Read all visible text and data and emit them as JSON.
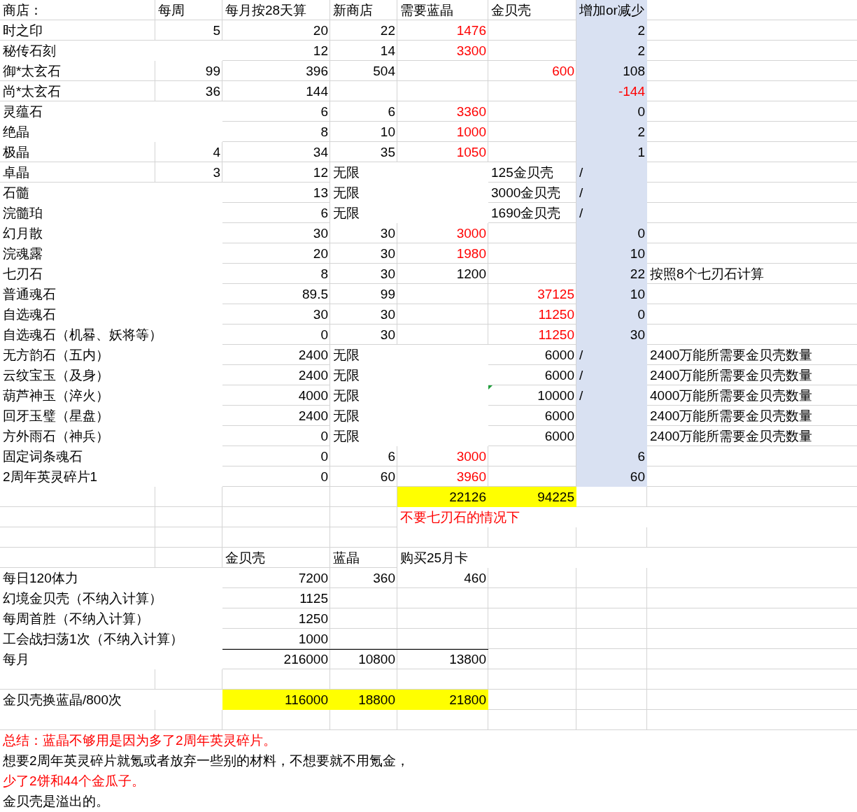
{
  "rows": [
    {
      "cells": [
        {
          "text": "商店：",
          "kind": "text"
        },
        {
          "text": "每周",
          "kind": "text"
        },
        {
          "text": "每月按28天算",
          "kind": "text"
        },
        {
          "text": "新商店",
          "kind": "text"
        },
        {
          "text": "需要蓝晶",
          "kind": "text"
        },
        {
          "text": "金贝壳",
          "kind": "text"
        },
        {
          "text": "增加or减少",
          "kind": "delta-text"
        },
        null
      ]
    },
    {
      "cells": [
        {
          "text": "时之印",
          "kind": "text"
        },
        {
          "text": "5",
          "kind": "number"
        },
        {
          "text": "20",
          "kind": "number"
        },
        {
          "text": "22",
          "kind": "number"
        },
        {
          "text": "1476",
          "kind": "number",
          "color": "#ff0000"
        },
        null,
        {
          "text": "2",
          "kind": "delta"
        },
        null
      ]
    },
    {
      "cells": [
        {
          "text": "秘传石刻",
          "kind": "text"
        },
        null,
        {
          "text": "12",
          "kind": "number"
        },
        {
          "text": "14",
          "kind": "number"
        },
        {
          "text": "3300",
          "kind": "number",
          "color": "#ff0000"
        },
        null,
        {
          "text": "2",
          "kind": "delta"
        },
        null
      ]
    },
    {
      "cells": [
        {
          "text": "御*太玄石",
          "kind": "text"
        },
        {
          "text": "99",
          "kind": "number"
        },
        {
          "text": "396",
          "kind": "number"
        },
        {
          "text": "504",
          "kind": "number"
        },
        null,
        {
          "text": "600",
          "kind": "number",
          "color": "#ff0000"
        },
        {
          "text": "108",
          "kind": "delta"
        },
        null
      ]
    },
    {
      "cells": [
        {
          "text": "尚*太玄石",
          "kind": "text"
        },
        {
          "text": "36",
          "kind": "number"
        },
        {
          "text": "144",
          "kind": "number"
        },
        null,
        null,
        null,
        {
          "text": "-144",
          "kind": "delta",
          "color": "#ff0000"
        },
        null
      ]
    },
    {
      "cells": [
        {
          "text": "灵蕴石",
          "kind": "text"
        },
        null,
        {
          "text": "6",
          "kind": "number"
        },
        {
          "text": "6",
          "kind": "number"
        },
        {
          "text": "3360",
          "kind": "number",
          "color": "#ff0000"
        },
        null,
        {
          "text": "0",
          "kind": "delta"
        },
        null
      ]
    },
    {
      "cells": [
        {
          "text": "绝晶",
          "kind": "text"
        },
        null,
        {
          "text": "8",
          "kind": "number"
        },
        {
          "text": "10",
          "kind": "number"
        },
        {
          "text": "1000",
          "kind": "number",
          "color": "#ff0000"
        },
        null,
        {
          "text": "2",
          "kind": "delta"
        },
        null
      ]
    },
    {
      "cells": [
        {
          "text": "极晶",
          "kind": "text"
        },
        {
          "text": "4",
          "kind": "number"
        },
        {
          "text": "34",
          "kind": "number"
        },
        {
          "text": "35",
          "kind": "number"
        },
        {
          "text": "1050",
          "kind": "number",
          "color": "#ff0000"
        },
        null,
        {
          "text": "1",
          "kind": "delta"
        },
        null
      ]
    },
    {
      "cells": [
        {
          "text": "卓晶",
          "kind": "text"
        },
        {
          "text": "3",
          "kind": "number"
        },
        {
          "text": "12",
          "kind": "number"
        },
        {
          "text": "无限",
          "kind": "text"
        },
        null,
        {
          "text": "125金贝壳",
          "kind": "text"
        },
        {
          "text": "/",
          "kind": "delta-text"
        },
        null
      ]
    },
    {
      "cells": [
        {
          "text": "石髓",
          "kind": "text"
        },
        null,
        {
          "text": "13",
          "kind": "number"
        },
        {
          "text": "无限",
          "kind": "text"
        },
        null,
        {
          "text": "3000金贝壳",
          "kind": "text"
        },
        {
          "text": "/",
          "kind": "delta-text"
        },
        null
      ]
    },
    {
      "cells": [
        {
          "text": "浣髓珀",
          "kind": "text"
        },
        null,
        {
          "text": "6",
          "kind": "number"
        },
        {
          "text": "无限",
          "kind": "text"
        },
        null,
        {
          "text": "1690金贝壳",
          "kind": "text"
        },
        {
          "text": "/",
          "kind": "delta-text"
        },
        null
      ]
    },
    {
      "cells": [
        {
          "text": "幻月散",
          "kind": "text"
        },
        null,
        {
          "text": "30",
          "kind": "number"
        },
        {
          "text": "30",
          "kind": "number"
        },
        {
          "text": "3000",
          "kind": "number",
          "color": "#ff0000"
        },
        null,
        {
          "text": "0",
          "kind": "delta"
        },
        null
      ]
    },
    {
      "cells": [
        {
          "text": "浣魂露",
          "kind": "text"
        },
        null,
        {
          "text": "20",
          "kind": "number"
        },
        {
          "text": "30",
          "kind": "number"
        },
        {
          "text": "1980",
          "kind": "number",
          "color": "#ff0000"
        },
        null,
        {
          "text": "10",
          "kind": "delta"
        },
        null
      ]
    },
    {
      "cells": [
        {
          "text": "七刃石",
          "kind": "text"
        },
        null,
        {
          "text": "8",
          "kind": "number"
        },
        {
          "text": "30",
          "kind": "number"
        },
        {
          "text": "1200",
          "kind": "number"
        },
        null,
        {
          "text": "22",
          "kind": "delta"
        },
        {
          "text": "按照8个七刃石计算",
          "kind": "text"
        }
      ]
    },
    {
      "cells": [
        {
          "text": "普通魂石",
          "kind": "text"
        },
        null,
        {
          "text": "89.5",
          "kind": "number"
        },
        {
          "text": "99",
          "kind": "number"
        },
        null,
        {
          "text": "37125",
          "kind": "number",
          "color": "#ff0000"
        },
        {
          "text": "10",
          "kind": "delta"
        },
        null
      ]
    },
    {
      "cells": [
        {
          "text": "自选魂石",
          "kind": "text"
        },
        null,
        {
          "text": "30",
          "kind": "number"
        },
        {
          "text": "30",
          "kind": "number"
        },
        null,
        {
          "text": "11250",
          "kind": "number",
          "color": "#ff0000"
        },
        {
          "text": "0",
          "kind": "delta"
        },
        null
      ]
    },
    {
      "cells": [
        {
          "text": "自选魂石（机晷、妖将等）",
          "kind": "text"
        },
        null,
        {
          "text": "0",
          "kind": "number"
        },
        {
          "text": "30",
          "kind": "number"
        },
        null,
        {
          "text": "11250",
          "kind": "number",
          "color": "#ff0000"
        },
        {
          "text": "30",
          "kind": "delta"
        },
        null
      ]
    },
    {
      "cells": [
        {
          "text": "无方韵石（五内）",
          "kind": "text"
        },
        null,
        {
          "text": "2400",
          "kind": "number"
        },
        {
          "text": "无限",
          "kind": "text"
        },
        null,
        {
          "text": "6000",
          "kind": "number"
        },
        {
          "text": "/",
          "kind": "delta-text"
        },
        {
          "text": "2400万能所需要金贝壳数量",
          "kind": "text"
        }
      ]
    },
    {
      "cells": [
        {
          "text": "云纹宝玉（及身）",
          "kind": "text"
        },
        null,
        {
          "text": "2400",
          "kind": "number"
        },
        {
          "text": "无限",
          "kind": "text"
        },
        null,
        {
          "text": "6000",
          "kind": "number"
        },
        {
          "text": "/",
          "kind": "delta-text"
        },
        {
          "text": "2400万能所需要金贝壳数量",
          "kind": "text"
        }
      ]
    },
    {
      "cells": [
        {
          "text": "葫芦神玉（淬火）",
          "kind": "text"
        },
        null,
        {
          "text": "4000",
          "kind": "number"
        },
        {
          "text": "无限",
          "kind": "text"
        },
        null,
        {
          "text": "10000",
          "kind": "number",
          "flag": true
        },
        {
          "text": "/",
          "kind": "delta-text"
        },
        {
          "text": "4000万能所需要金贝壳数量",
          "kind": "text"
        }
      ]
    },
    {
      "cells": [
        {
          "text": "回牙玉璧（星盘）",
          "kind": "text"
        },
        null,
        {
          "text": "2400",
          "kind": "number"
        },
        {
          "text": "无限",
          "kind": "text"
        },
        null,
        {
          "text": "6000",
          "kind": "number"
        },
        {
          "kind": "blank-delta"
        },
        {
          "text": "2400万能所需要金贝壳数量",
          "kind": "text"
        }
      ]
    },
    {
      "cells": [
        {
          "text": "方外雨石（神兵）",
          "kind": "text"
        },
        null,
        {
          "text": "0",
          "kind": "number"
        },
        {
          "text": "无限",
          "kind": "text"
        },
        null,
        {
          "text": "6000",
          "kind": "number"
        },
        {
          "kind": "blank-delta"
        },
        {
          "text": "2400万能所需要金贝壳数量",
          "kind": "text"
        }
      ]
    },
    {
      "cells": [
        {
          "text": "固定词条魂石",
          "kind": "text"
        },
        null,
        {
          "text": "0",
          "kind": "number"
        },
        {
          "text": "6",
          "kind": "number"
        },
        {
          "text": "3000",
          "kind": "number",
          "color": "#ff0000"
        },
        null,
        {
          "text": "6",
          "kind": "delta"
        },
        null
      ]
    },
    {
      "cells": [
        {
          "text": "2周年英灵碎片1",
          "kind": "text"
        },
        null,
        {
          "text": "0",
          "kind": "number"
        },
        {
          "text": "60",
          "kind": "number"
        },
        {
          "text": "3960",
          "kind": "number",
          "color": "#ff0000"
        },
        null,
        {
          "text": "60",
          "kind": "delta"
        },
        null
      ]
    },
    {
      "cells": [
        null,
        null,
        null,
        null,
        {
          "text": "22126",
          "kind": "total"
        },
        {
          "text": "94225",
          "kind": "total"
        },
        null,
        null
      ]
    },
    {
      "cells": [
        null,
        null,
        null,
        null,
        {
          "text": "不要七刃石的情况下",
          "kind": "text",
          "color": "#ff0000"
        },
        null,
        null,
        null
      ]
    },
    {
      "cells": [
        null,
        null,
        null,
        null,
        null,
        null,
        null,
        null
      ]
    },
    {
      "cells": [
        null,
        null,
        {
          "text": "金贝壳",
          "kind": "text"
        },
        {
          "text": "蓝晶",
          "kind": "text"
        },
        {
          "text": "购买25月卡",
          "kind": "text"
        },
        null,
        null,
        null
      ]
    },
    {
      "cells": [
        {
          "text": "每日120体力",
          "kind": "text"
        },
        null,
        {
          "text": "7200",
          "kind": "number"
        },
        {
          "text": "360",
          "kind": "number"
        },
        {
          "text": "460",
          "kind": "number"
        },
        null,
        null,
        null
      ]
    },
    {
      "cells": [
        {
          "text": "幻境金贝壳（不纳入计算）",
          "kind": "text"
        },
        null,
        {
          "text": "1125",
          "kind": "number"
        },
        null,
        null,
        null,
        null,
        null
      ]
    },
    {
      "cells": [
        {
          "text": "每周首胜（不纳入计算）",
          "kind": "text"
        },
        null,
        {
          "text": "1250",
          "kind": "number"
        },
        null,
        null,
        null,
        null,
        null
      ]
    },
    {
      "cells": [
        {
          "text": "工会战扫荡1次（不纳入计算）",
          "kind": "text"
        },
        null,
        {
          "text": "1000",
          "kind": "number"
        },
        null,
        null,
        null,
        null,
        null
      ]
    },
    {
      "cells": [
        {
          "text": "每月",
          "kind": "text"
        },
        null,
        {
          "text": "216000",
          "kind": "number",
          "rule_above": true
        },
        {
          "text": "10800",
          "kind": "number",
          "rule_above": true
        },
        {
          "text": "13800",
          "kind": "number",
          "rule_above": true
        },
        null,
        null,
        null
      ]
    },
    {
      "cells": [
        null,
        null,
        null,
        null,
        null,
        null,
        null,
        null
      ]
    },
    {
      "cells": [
        {
          "text": "金贝壳换蓝晶/800次",
          "kind": "text"
        },
        null,
        {
          "text": "116000",
          "kind": "total"
        },
        {
          "text": "18800",
          "kind": "total"
        },
        {
          "text": "21800",
          "kind": "total"
        },
        null,
        null,
        null
      ]
    },
    {
      "cells": [
        null,
        null,
        null,
        null,
        null,
        null,
        null,
        null
      ]
    },
    {
      "cells": [
        {
          "text": "总结：蓝晶不够用是因为多了2周年英灵碎片。",
          "kind": "text",
          "color": "#ff0000"
        },
        null,
        null,
        null,
        null,
        null,
        null,
        null
      ]
    },
    {
      "cells": [
        {
          "text": "想要2周年英灵碎片就氪或者放弃一些别的材料，不想要就不用氪金，",
          "kind": "text"
        },
        null,
        null,
        null,
        null,
        null,
        null,
        null
      ]
    },
    {
      "cells": [
        {
          "text": "少了2饼和44个金瓜子。",
          "kind": "text",
          "color": "#ff0000"
        },
        null,
        null,
        null,
        null,
        null,
        null,
        null
      ]
    },
    {
      "cells": [
        {
          "text": "金贝壳是溢出的。",
          "kind": "text"
        },
        null,
        null,
        null,
        null,
        null,
        null,
        null
      ]
    }
  ]
}
